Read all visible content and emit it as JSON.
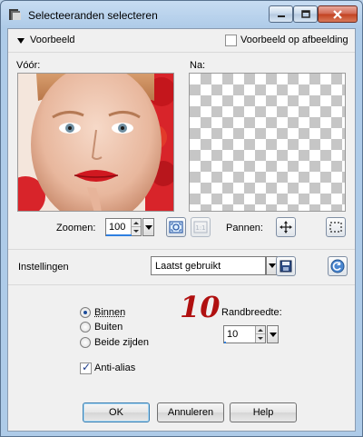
{
  "window": {
    "title": "Selecteeranden selecteren",
    "colors": {
      "titlebar": "#aecbe8",
      "close_button": "#c2401f",
      "annotation": "#b01010"
    }
  },
  "preview": {
    "section_label": "Voorbeeld",
    "preview_on_image_label": "Voorbeeld op afbeelding",
    "preview_on_image_checked": false,
    "before_label": "Vóór:",
    "after_label": "Na:",
    "zoom_label": "Zoomen:",
    "zoom_value": "100",
    "pan_label": "Pannen:"
  },
  "settings": {
    "label": "Instellingen",
    "preset_value": "Laatst gebruikt"
  },
  "options": {
    "radio_inside": "Binnen",
    "radio_outside": "Buiten",
    "radio_both": "Beide zijden",
    "selected": "Binnen",
    "antialias_label": "Anti-alias",
    "antialias_checked": true,
    "border_width_label": "Randbreedte:",
    "border_width_value": "10",
    "annotation_number": "10"
  },
  "buttons": {
    "ok": "OK",
    "cancel": "Annuleren",
    "help": "Help"
  }
}
